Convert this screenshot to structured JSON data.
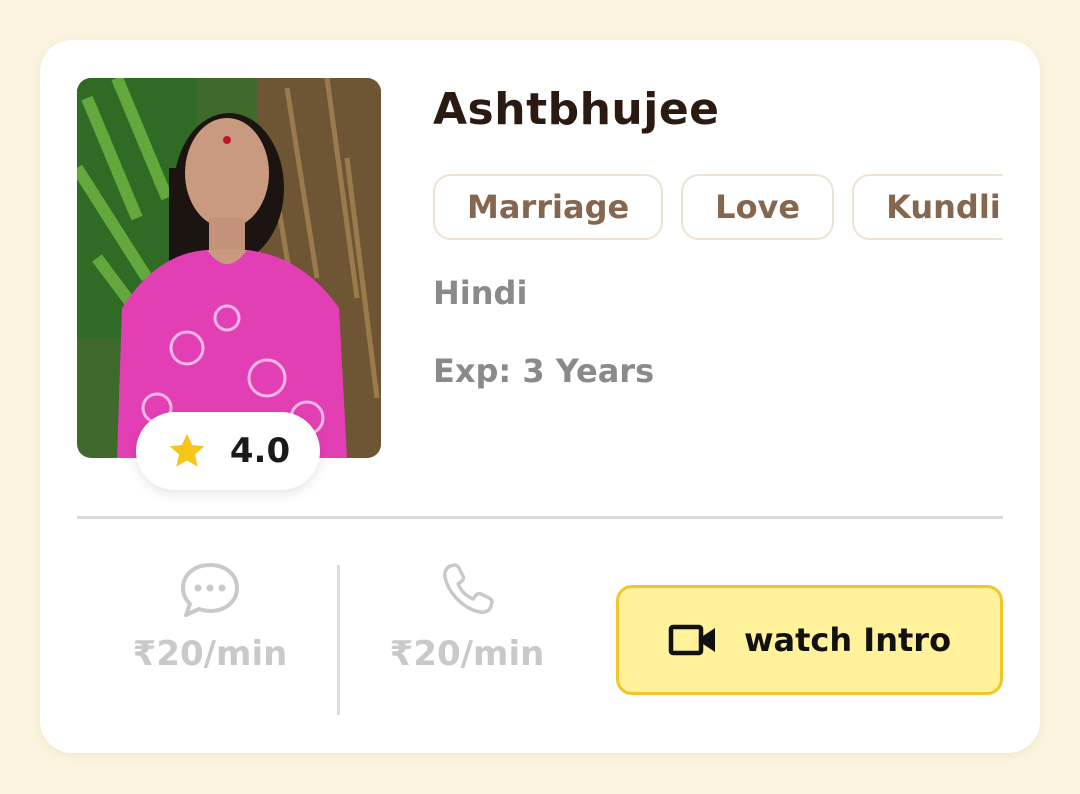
{
  "profile": {
    "name": "Ashtbhujee",
    "rating": "4.0",
    "tags": [
      "Marriage",
      "Love",
      "Kundli"
    ],
    "language": "Hindi",
    "experience": "Exp: 3 Years"
  },
  "pricing": {
    "chat_price": "₹20/min",
    "call_price": "₹20/min"
  },
  "actions": {
    "watch_intro_label": "watch Intro"
  },
  "colors": {
    "page_background": "#fbf5df",
    "card_background": "#ffffff",
    "name_color": "#2b1a12",
    "tag_text": "#85664f",
    "tag_border": "#ece3d4",
    "meta_text": "#8a8a8a",
    "price_text": "#c9c9c9",
    "star": "#f5c518",
    "button_fill": "#fff29a",
    "button_border": "#f2c528"
  },
  "icons": {
    "rating": "star-icon",
    "chat": "chat-bubble-icon",
    "call": "phone-icon",
    "intro": "video-camera-icon"
  }
}
